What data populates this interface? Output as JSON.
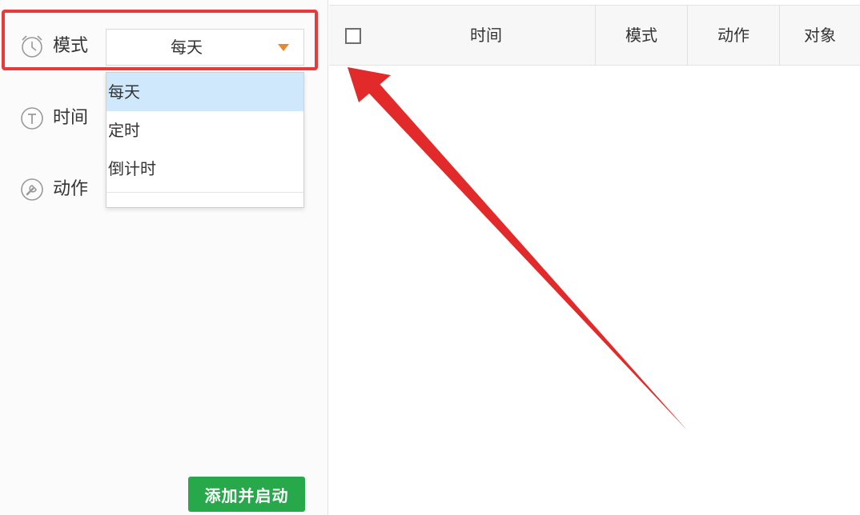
{
  "form": {
    "mode_label": "模式",
    "time_label": "时间",
    "action_label": "动作",
    "mode_select": {
      "selected": "每天",
      "options": [
        "每天",
        "定时",
        "倒计时"
      ]
    },
    "add_button_label": "添加并启动"
  },
  "table": {
    "columns": [
      "时间",
      "模式",
      "动作",
      "对象"
    ]
  },
  "icons": {
    "mode": "alarm-clock-icon",
    "time": "timer-icon",
    "action": "wrench-icon",
    "dropdown": "caret-down-icon"
  },
  "colors": {
    "highlight_frame": "#e83a3a",
    "arrow": "#e32a2a",
    "add_button": "#27a84a",
    "caret": "#e8872e",
    "selected_option": "#cfe8fb"
  }
}
